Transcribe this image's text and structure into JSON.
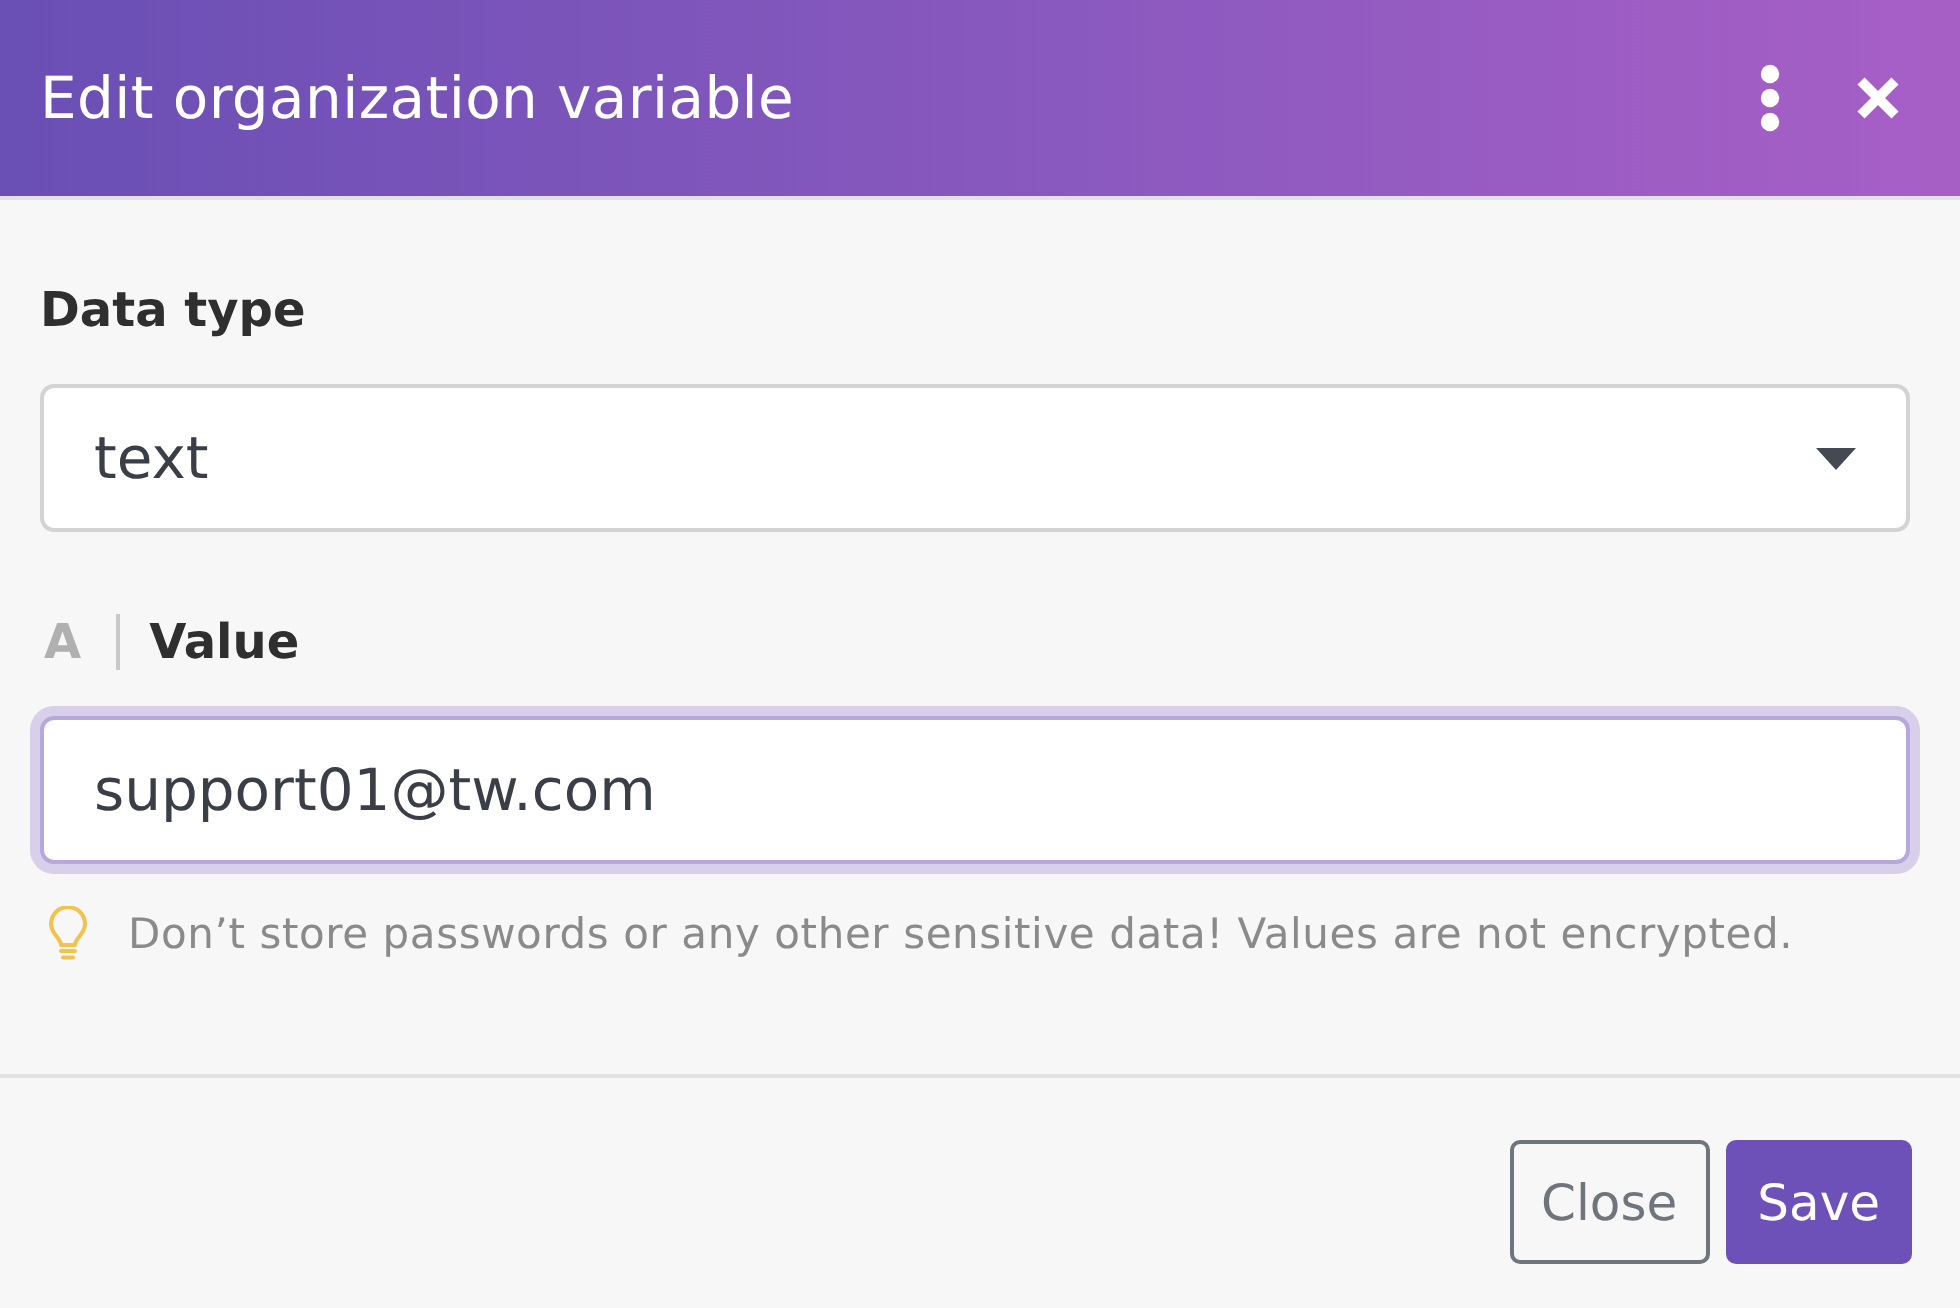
{
  "dialog": {
    "title": "Edit organization variable"
  },
  "fields": [
    {
      "kind": "select",
      "label": "Data type",
      "value": "text",
      "focused": false
    },
    {
      "kind": "input",
      "type_symbol": "A",
      "label": "Value",
      "value": "support01@tw.com",
      "focused": true
    }
  ],
  "hint": "Don’t store passwords or any other sensitive data! Values are not encrypted.",
  "buttons": [
    {
      "kind": "secondary",
      "label": "Close"
    },
    {
      "kind": "primary",
      "label": "Save"
    }
  ]
}
